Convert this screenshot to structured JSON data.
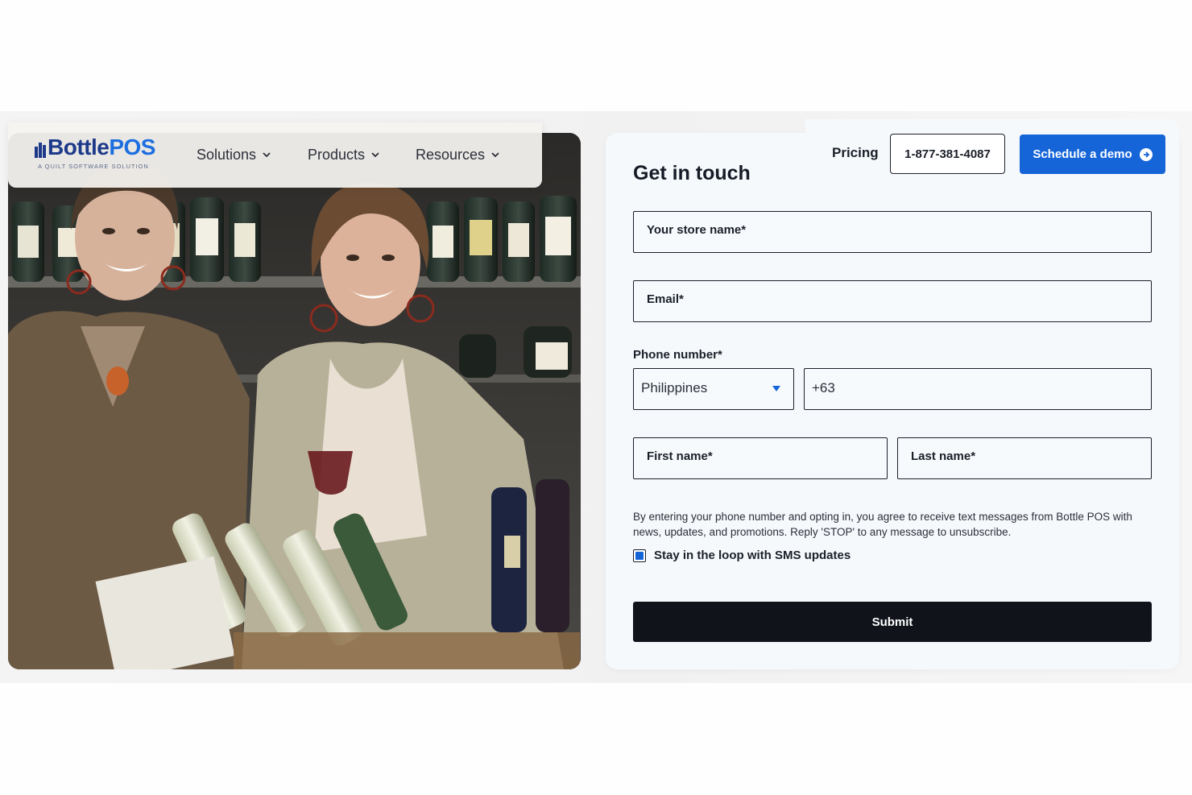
{
  "brand": {
    "logo_text_1": "Bottle",
    "logo_text_2": "POS",
    "tagline": "A QUILT SOFTWARE SOLUTION",
    "primary_color": "#1565d8",
    "dark_color": "#10131a"
  },
  "nav": {
    "items": [
      {
        "label": "Solutions",
        "icon": "chevron-down-icon"
      },
      {
        "label": "Products",
        "icon": "chevron-down-icon"
      },
      {
        "label": "Resources",
        "icon": "chevron-down-icon"
      }
    ],
    "pricing_label": "Pricing",
    "phone_label": "1-877-381-4087",
    "demo_label": "Schedule a demo",
    "demo_icon": "arrow-right-circle-icon"
  },
  "form": {
    "title": "Get in touch",
    "store_name_placeholder": "Your store name*",
    "email_placeholder": "Email*",
    "phone_label": "Phone number*",
    "country_value": "Philippines",
    "dial_code_value": "+63",
    "first_name_placeholder": "First name*",
    "last_name_placeholder": "Last name*",
    "disclaimer": "By entering your phone number and opting in, you agree to receive text messages from Bottle POS with news, updates, and promotions. Reply 'STOP' to any message to unsubscribe.",
    "sms_checkbox_label": "Stay in the loop with SMS updates",
    "sms_checked": true,
    "submit_label": "Submit"
  }
}
